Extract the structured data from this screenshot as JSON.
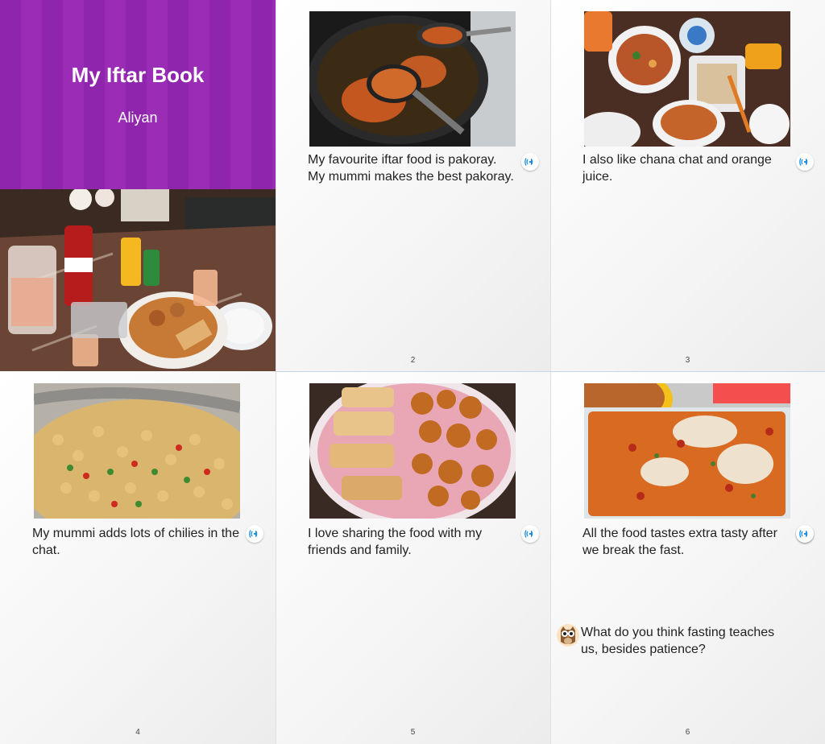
{
  "cover": {
    "title": "My Iftar Book",
    "author": "Aliyan"
  },
  "pages": [
    {
      "number": "2",
      "text": "My favourite iftar food is pakoray. My mummi makes the best pakoray.",
      "photo_desc": "pakoray frying in a wok"
    },
    {
      "number": "3",
      "text": "I also like chana chat and orange juice.",
      "photo_desc": "iftar table spread"
    },
    {
      "number": "4",
      "text": "My mummi adds lots of chilies in the chat.",
      "photo_desc": "chana chat"
    },
    {
      "number": "5",
      "text": "I love sharing the food with my friends and family.",
      "photo_desc": "platter of rolls and pakoray"
    },
    {
      "number": "6",
      "text": "All the food tastes extra tasty after we break the fast.",
      "photo_desc": "baked pasta dish"
    }
  ],
  "question": "What do you think fasting teaches us, besides patience?",
  "colors": {
    "cover_purple": "#9a2cb6",
    "audio_icon": "#1c8fe0"
  },
  "icons": {
    "audio": "speaker-wave-icon",
    "owl": "owl-avatar-icon"
  }
}
